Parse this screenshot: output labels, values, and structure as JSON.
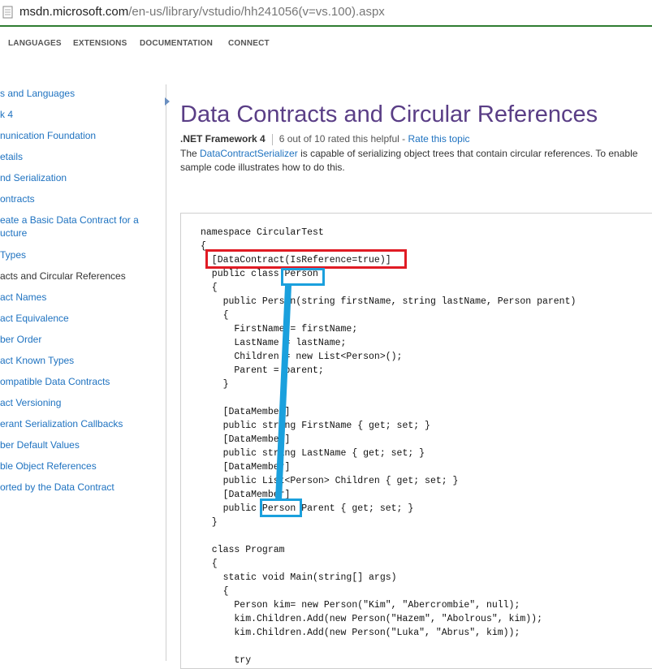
{
  "browser": {
    "url_host": "msdn.microsoft.com",
    "url_path": "/en-us/library/vstudio/hh241056(v=vs.100).aspx"
  },
  "nav": {
    "items": [
      "LANGUAGES",
      "EXTENSIONS",
      "DOCUMENTATION",
      "CONNECT"
    ]
  },
  "sidebar": {
    "items": [
      {
        "label": "s and Languages"
      },
      {
        "label": "k 4"
      },
      {
        "label": "nunication Foundation"
      },
      {
        "label": "etails"
      },
      {
        "label": "nd Serialization"
      },
      {
        "label": "ontracts"
      },
      {
        "label": "eate a Basic Data Contract for a"
      },
      {
        "label": "ucture"
      },
      {
        "label": " Types"
      },
      {
        "label": "acts and Circular References"
      },
      {
        "label": "act Names"
      },
      {
        "label": "act Equivalence"
      },
      {
        "label": "ber Order"
      },
      {
        "label": "act Known Types"
      },
      {
        "label": "ompatible Data Contracts"
      },
      {
        "label": "act Versioning"
      },
      {
        "label": "erant Serialization Callbacks"
      },
      {
        "label": "ber Default Values"
      },
      {
        "label": "ble Object References"
      },
      {
        "label": "orted by the Data Contract"
      }
    ]
  },
  "main": {
    "title": "Data Contracts and Circular References",
    "framework": ".NET Framework 4",
    "rating": "6 out of 10 rated this helpful",
    "rating_dash": " - ",
    "rate_link": "Rate this topic",
    "intro_prefix": "The ",
    "intro_link": "DataContractSerializer",
    "intro_line1_rest": " is capable of serializing object trees that contain circular references. To enable",
    "intro_line2": "sample code illustrates how to do this."
  },
  "code": {
    "lines": [
      "namespace CircularTest",
      "{",
      "  [DataContract(IsReference=true)]",
      "  public class Person",
      "  {",
      "    public Person(string firstName, string lastName, Person parent)",
      "    {",
      "      FirstName = firstName;",
      "      LastName = lastName;",
      "      Children = new List<Person>();",
      "      Parent = parent;",
      "    }",
      "",
      "    [DataMember]",
      "    public string FirstName { get; set; }",
      "    [DataMember]",
      "    public string LastName { get; set; }",
      "    [DataMember]",
      "    public List<Person> Children { get; set; }",
      "    [DataMember]",
      "    public Person Parent { get; set; }",
      "  }",
      "",
      "  class Program",
      "  {",
      "    static void Main(string[] args)",
      "    {",
      "      Person kim= new Person(\"Kim\", \"Abercrombie\", null);",
      "      kim.Children.Add(new Person(\"Hazem\", \"Abolrous\", kim));",
      "      kim.Children.Add(new Person(\"Luka\", \"Abrus\", kim));",
      "",
      "      try"
    ]
  },
  "colors": {
    "title": "#5a3e86",
    "link": "#1e72c0",
    "annotation_red": "#e01b24",
    "annotation_blue": "#1aa0dd",
    "url_border": "#2f7d32"
  }
}
